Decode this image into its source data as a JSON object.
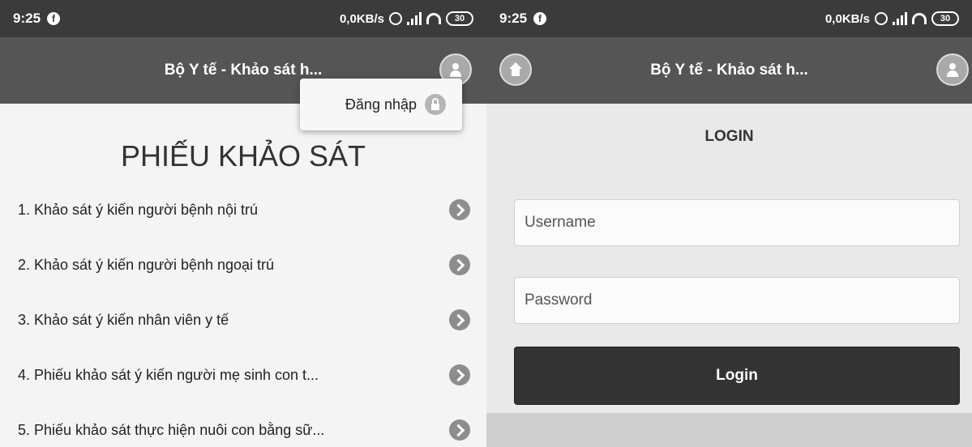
{
  "status_bar": {
    "time": "9:25",
    "network_speed": "0,0KB/s",
    "battery_level": "30"
  },
  "header": {
    "title": "Bộ Y tế - Khảo sát h..."
  },
  "dropdown": {
    "login_label": "Đăng nhập"
  },
  "survey": {
    "title": "PHIẾU KHẢO SÁT",
    "items": [
      {
        "label": "1. Khảo sát ý kiến người bệnh nội trú"
      },
      {
        "label": "2. Khảo sát ý kiến người bệnh ngoại trú"
      },
      {
        "label": "3. Khảo sát ý kiến nhân viên y tế"
      },
      {
        "label": "4. Phiếu khảo sát ý kiến người mẹ sinh con t..."
      },
      {
        "label": "5. Phiếu khảo sát thực hiện nuôi con bằng sữ..."
      }
    ]
  },
  "login": {
    "title": "LOGIN",
    "username_placeholder": "Username",
    "password_placeholder": "Password",
    "button_label": "Login"
  },
  "colors": {
    "status_bar": "#3b3b3b",
    "header": "#555555",
    "login_button": "#333333"
  }
}
